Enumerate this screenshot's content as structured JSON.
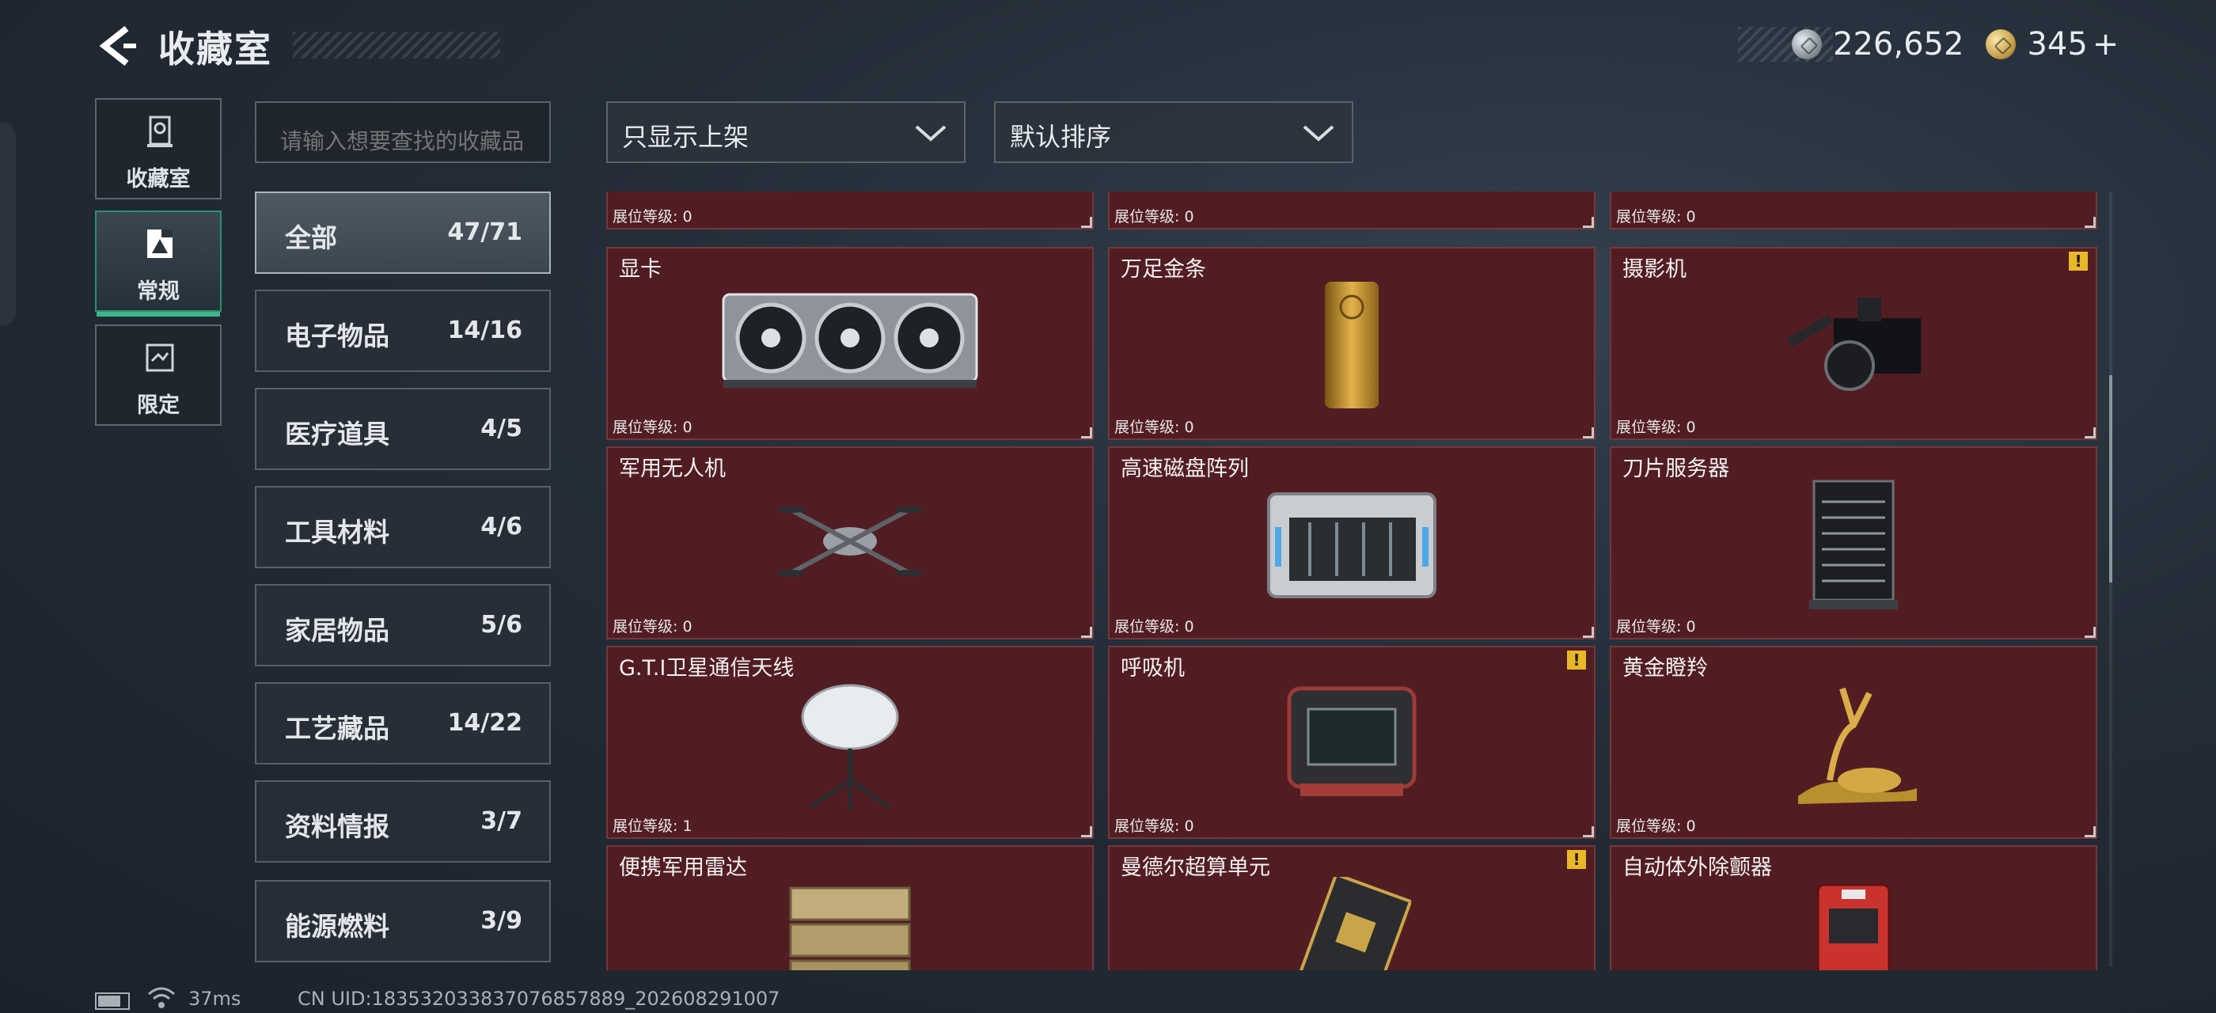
{
  "header": {
    "title": "收藏室"
  },
  "currency": {
    "silver": "226,652",
    "gold": "345",
    "gold_plus": "+"
  },
  "nav": [
    {
      "label": "收藏室",
      "icon": "collection-icon"
    },
    {
      "label": "常规",
      "icon": "regular-icon",
      "active": true
    },
    {
      "label": "限定",
      "icon": "limited-icon"
    }
  ],
  "search": {
    "placeholder": "请输入想要查找的收藏品"
  },
  "filters": {
    "shelf": "只显示上架",
    "sort": "默认排序"
  },
  "categories": [
    {
      "name": "全部",
      "count": "47/71",
      "active": true
    },
    {
      "name": "电子物品",
      "count": "14/16"
    },
    {
      "name": "医疗道具",
      "count": "4/5"
    },
    {
      "name": "工具材料",
      "count": "4/6"
    },
    {
      "name": "家居物品",
      "count": "5/6"
    },
    {
      "name": "工艺藏品",
      "count": "14/22"
    },
    {
      "name": "资料情报",
      "count": "3/7"
    },
    {
      "name": "能源燃料",
      "count": "3/9"
    }
  ],
  "items_top_partial": [
    {
      "level": "展位等级: 0"
    },
    {
      "level": "展位等级: 0"
    },
    {
      "level": "展位等级: 0"
    }
  ],
  "items": [
    {
      "name": "显卡",
      "level": "展位等级: 0",
      "image": "graphics-card-icon"
    },
    {
      "name": "万足金条",
      "level": "展位等级: 0",
      "image": "gold-bar-icon"
    },
    {
      "name": "摄影机",
      "level": "展位等级: 0",
      "image": "camera-icon",
      "alert": true
    },
    {
      "name": "军用无人机",
      "level": "展位等级: 0",
      "image": "drone-icon"
    },
    {
      "name": "高速磁盘阵列",
      "level": "展位等级: 0",
      "image": "disk-array-icon"
    },
    {
      "name": "刀片服务器",
      "level": "展位等级: 0",
      "image": "blade-server-icon"
    },
    {
      "name": "G.T.I卫星通信天线",
      "level": "展位等级: 1",
      "image": "satellite-antenna-icon"
    },
    {
      "name": "呼吸机",
      "level": "展位等级: 0",
      "image": "ventilator-icon",
      "alert": true
    },
    {
      "name": "黄金瞪羚",
      "level": "展位等级: 0",
      "image": "golden-gazelle-icon"
    },
    {
      "name": "便携军用雷达",
      "level": "",
      "image": "radar-icon"
    },
    {
      "name": "曼德尔超算单元",
      "level": "",
      "image": "supercomputer-unit-icon",
      "alert": true
    },
    {
      "name": "自动体外除颤器",
      "level": "",
      "image": "defibrillator-icon"
    }
  ],
  "alert_symbol": "!",
  "status": {
    "ping": "37ms",
    "uid": "CN UID:18353203383707685788​9_202608291007"
  }
}
